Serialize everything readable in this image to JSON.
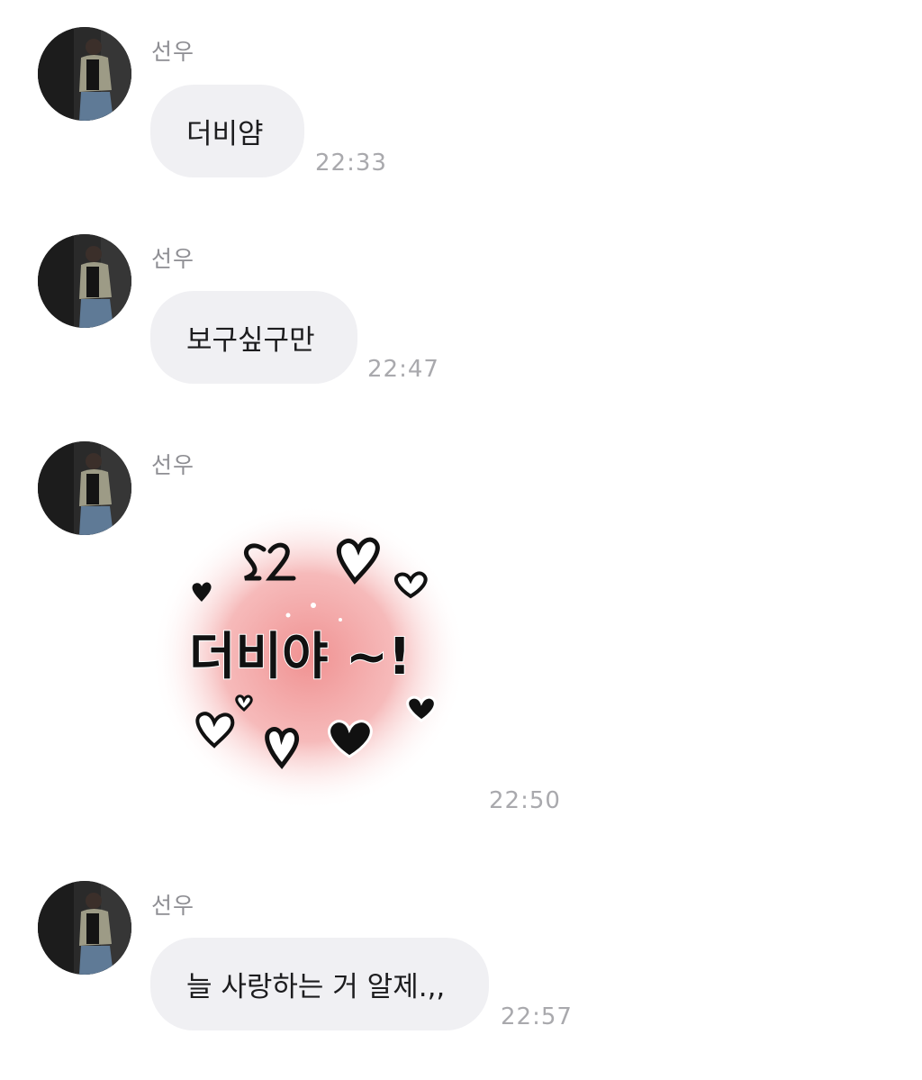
{
  "messages": [
    {
      "sender": "선우",
      "type": "text",
      "text": "더비얌",
      "time": "22:33"
    },
    {
      "sender": "선우",
      "type": "text",
      "text": "보구싶구만",
      "time": "22:47"
    },
    {
      "sender": "선우",
      "type": "sticker",
      "sticker_text": "더비야 ~!",
      "time": "22:50",
      "sticker_colors": {
        "glow": "#ef8b8b",
        "ink": "#111111"
      }
    },
    {
      "sender": "선우",
      "type": "text",
      "text": "늘 사랑하는 거 알제.,,",
      "time": "22:57"
    }
  ],
  "colors": {
    "bubble": "#f0f0f3",
    "sender_name": "#8e8e93",
    "timestamp": "#a9a9ad",
    "message_text": "#1c1c1e"
  },
  "icons": {
    "avatar": "profile-photo-avatar",
    "sticker": "heart-sticker"
  }
}
